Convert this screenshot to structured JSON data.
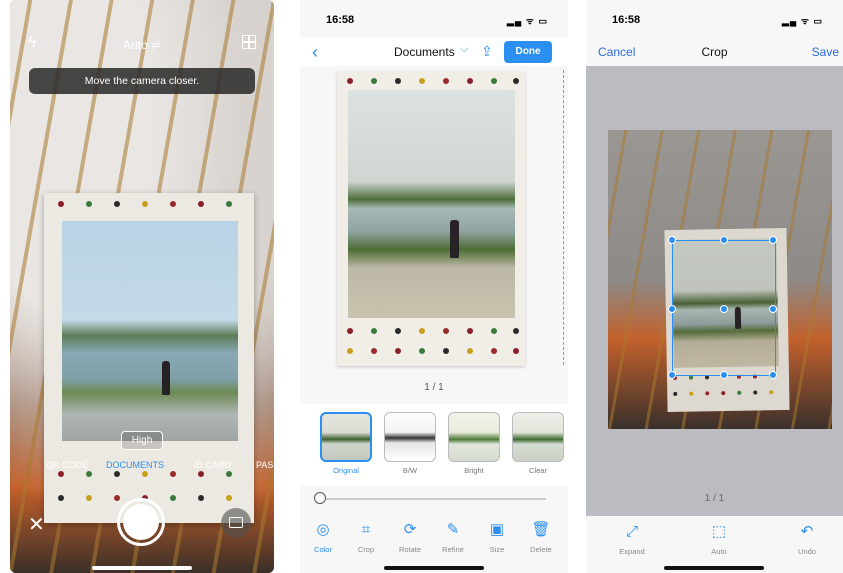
{
  "camera": {
    "flash_icon": "flash-auto-icon",
    "mode_label": "Auto ≓",
    "toast": "Move the camera closer.",
    "quality_badge": "High",
    "modes": [
      "QR CODE",
      "DOCUMENTS",
      "ID CARD",
      "PAS"
    ],
    "active_mode_index": 1
  },
  "documents": {
    "status_time": "16:58",
    "status_icons": "▂▄ ᯤ ▭",
    "title": "Documents",
    "done_label": "Done",
    "pager": "1 / 1",
    "filters": [
      {
        "label": "Original",
        "selected": true
      },
      {
        "label": "B/W",
        "selected": false
      },
      {
        "label": "Bright",
        "selected": false
      },
      {
        "label": "Clear",
        "selected": false
      }
    ],
    "tools": [
      {
        "label": "Color",
        "icon": "color-icon"
      },
      {
        "label": "Crop",
        "icon": "crop-icon"
      },
      {
        "label": "Rotate",
        "icon": "rotate-icon"
      },
      {
        "label": "Refine",
        "icon": "refine-icon"
      },
      {
        "label": "Size",
        "icon": "size-icon"
      },
      {
        "label": "Delete",
        "icon": "trash-icon"
      }
    ],
    "slider_value": 0
  },
  "crop": {
    "status_time": "16:58",
    "status_icons": "▂▄ ᯤ ▭",
    "cancel_label": "Cancel",
    "title": "Crop",
    "save_label": "Save",
    "pager": "1 / 1",
    "tools": [
      {
        "label": "Expand",
        "icon": "expand-icon"
      },
      {
        "label": "Auto",
        "icon": "auto-crop-icon"
      },
      {
        "label": "Undo",
        "icon": "undo-icon"
      }
    ]
  },
  "colors": {
    "accent": "#2a8ff0",
    "link": "#2a6ae0"
  }
}
